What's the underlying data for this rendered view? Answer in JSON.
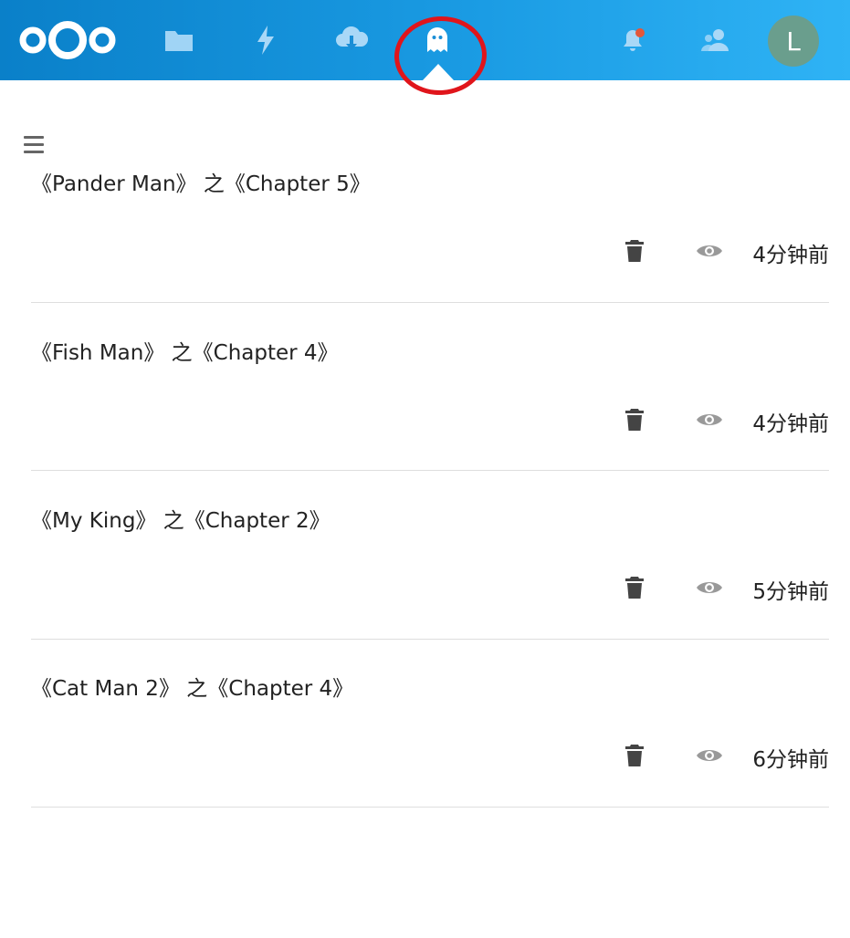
{
  "header": {
    "nav": [
      {
        "name": "files",
        "icon": "folder-icon"
      },
      {
        "name": "activity",
        "icon": "lightning-icon"
      },
      {
        "name": "cloud-download",
        "icon": "cloud-download-icon"
      },
      {
        "name": "ghost-app",
        "icon": "ghost-icon",
        "active": true
      },
      {
        "name": "notifications",
        "icon": "bell-icon"
      },
      {
        "name": "contacts",
        "icon": "contacts-icon"
      }
    ],
    "avatar_letter": "L",
    "colors": {
      "bar_start": "#0a80c9",
      "bar_end": "#2fb3f5",
      "avatar": "#6a9e8d",
      "notification_dot": "#e4573a",
      "highlight_ring": "#e0151b"
    }
  },
  "items": [
    {
      "title": "《Pander Man》 之《Chapter 5》",
      "time": "4分钟前"
    },
    {
      "title": "《Fish Man》 之《Chapter 4》",
      "time": "4分钟前"
    },
    {
      "title": "《My King》 之《Chapter 2》",
      "time": "5分钟前"
    },
    {
      "title": "《Cat Man 2》 之《Chapter 4》",
      "time": "6分钟前"
    }
  ]
}
